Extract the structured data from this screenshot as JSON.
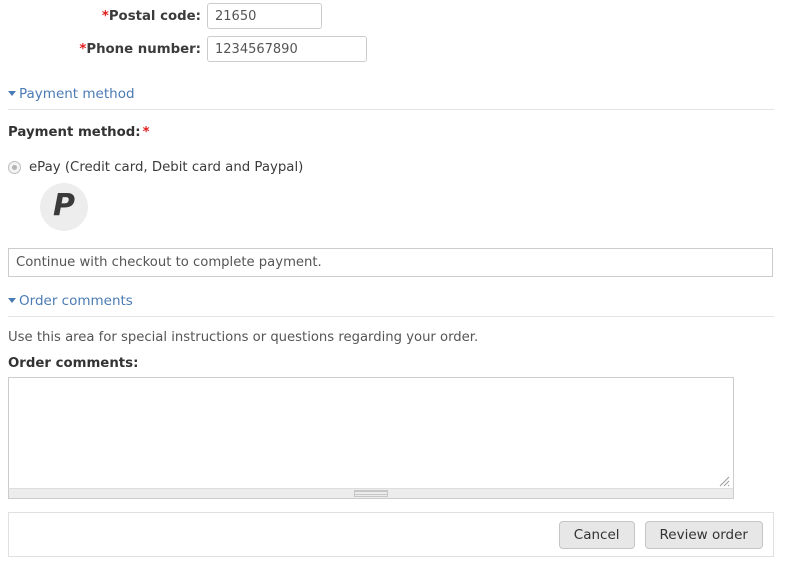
{
  "address_form": {
    "fields": [
      {
        "name": "postal-code",
        "label": "Postal code:",
        "required_marker": "*",
        "value": "21650",
        "placeholder": ""
      },
      {
        "name": "phone-number",
        "label": "Phone number:",
        "required_marker": "*",
        "value": "1234567890",
        "placeholder": ""
      }
    ]
  },
  "payment_section": {
    "legend": "Payment method",
    "heading": "Payment method:",
    "required_marker": "*",
    "options": [
      {
        "label": "ePay (Credit card, Debit card and Paypal)",
        "selected": true,
        "logo_letter": "P",
        "logo_name": "paypal-p-icon"
      }
    ],
    "notice": "Continue with checkout to complete payment."
  },
  "comments_section": {
    "legend": "Order comments",
    "description": "Use this area for special instructions or questions regarding your order.",
    "label": "Order comments:",
    "value": "",
    "placeholder": ""
  },
  "actions": {
    "cancel_label": "Cancel",
    "review_label": "Review order"
  },
  "colors": {
    "link": "#4b7bb5",
    "required": "#e01b1b",
    "text": "#3b3b3b",
    "border": "#cccccc",
    "button_bg": "#e7e7e7",
    "logo_bg": "#ededed"
  }
}
